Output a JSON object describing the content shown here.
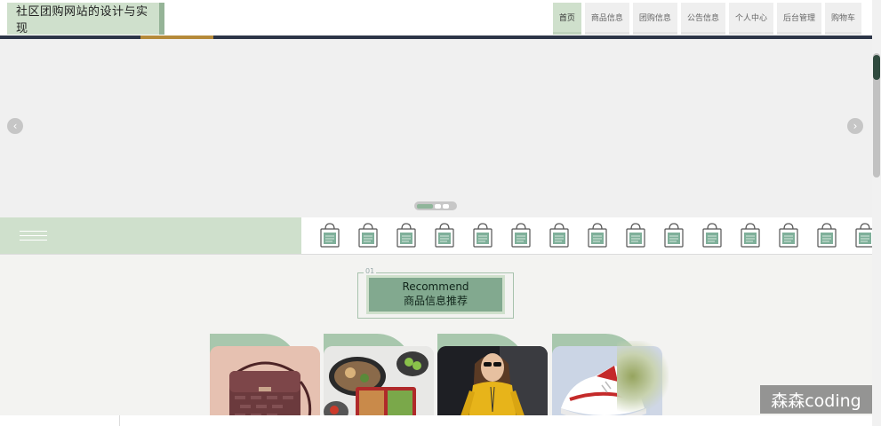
{
  "header": {
    "site_title": "社区团购网站的设计与实现",
    "nav": [
      {
        "label": "首页",
        "active": true
      },
      {
        "label": "商品信息",
        "active": false
      },
      {
        "label": "团购信息",
        "active": false
      },
      {
        "label": "公告信息",
        "active": false
      },
      {
        "label": "个人中心",
        "active": false
      },
      {
        "label": "后台管理",
        "active": false
      },
      {
        "label": "购物车",
        "active": false
      }
    ]
  },
  "banner": {
    "prev_symbol": "‹",
    "next_symbol": "›",
    "slide_count": 3,
    "active_slide": 0
  },
  "category_strip": {
    "menu_icon": "hamburger-icon",
    "item_icon": "shopping-bag-icon",
    "item_count": 15
  },
  "section": {
    "number": "01",
    "title_en": "Recommend",
    "title_cn": "商品信息推荐"
  },
  "products": [
    {
      "name": "handbag",
      "image_icon": "handbag-photo"
    },
    {
      "name": "food-box",
      "image_icon": "food-photo"
    },
    {
      "name": "sweater-woman",
      "image_icon": "woman-photo"
    },
    {
      "name": "sneaker",
      "image_icon": "sneaker-photo"
    }
  ],
  "watermark": "森森coding",
  "colors": {
    "accent": "#cfe0cc",
    "accent_dark": "#82a98f",
    "brand_border": "#95b497"
  }
}
